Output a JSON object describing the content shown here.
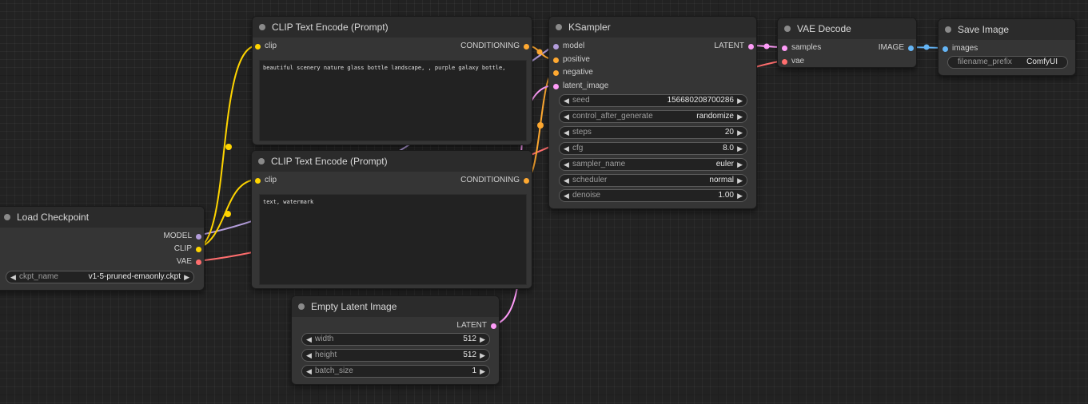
{
  "colors": {
    "canvas_bg": "#222222",
    "node_bg": "#353535",
    "node_title_bg": "#2b2b2b",
    "model": "#b39ddb",
    "clip": "#ffd500",
    "vae": "#ff6e6e",
    "conditioning": "#ffa931",
    "latent": "#ff9cf9",
    "image": "#64b5f6"
  },
  "nodes": {
    "load_checkpoint": {
      "title": "Load Checkpoint",
      "outputs": [
        "MODEL",
        "CLIP",
        "VAE"
      ],
      "widgets": [
        {
          "label": "ckpt_name",
          "value": "v1-5-pruned-emaonly.ckpt"
        }
      ]
    },
    "clip_positive": {
      "title": "CLIP Text Encode (Prompt)",
      "input": "clip",
      "output": "CONDITIONING",
      "text": "beautiful scenery nature glass bottle landscape, , purple galaxy bottle,"
    },
    "clip_negative": {
      "title": "CLIP Text Encode (Prompt)",
      "input": "clip",
      "output": "CONDITIONING",
      "text": "text, watermark"
    },
    "ksampler": {
      "title": "KSampler",
      "inputs": [
        "model",
        "positive",
        "negative",
        "latent_image"
      ],
      "output": "LATENT",
      "widgets": [
        {
          "label": "seed",
          "value": "156680208700286"
        },
        {
          "label": "control_after_generate",
          "value": "randomize"
        },
        {
          "label": "steps",
          "value": "20"
        },
        {
          "label": "cfg",
          "value": "8.0"
        },
        {
          "label": "sampler_name",
          "value": "euler"
        },
        {
          "label": "scheduler",
          "value": "normal"
        },
        {
          "label": "denoise",
          "value": "1.00"
        }
      ]
    },
    "vae_decode": {
      "title": "VAE Decode",
      "inputs": [
        "samples",
        "vae"
      ],
      "output": "IMAGE"
    },
    "save_image": {
      "title": "Save Image",
      "input": "images",
      "widgets": [
        {
          "label": "filename_prefix",
          "value": "ComfyUI"
        }
      ]
    },
    "empty_latent": {
      "title": "Empty Latent Image",
      "output": "LATENT",
      "widgets": [
        {
          "label": "width",
          "value": "512"
        },
        {
          "label": "height",
          "value": "512"
        },
        {
          "label": "batch_size",
          "value": "1"
        }
      ]
    }
  }
}
